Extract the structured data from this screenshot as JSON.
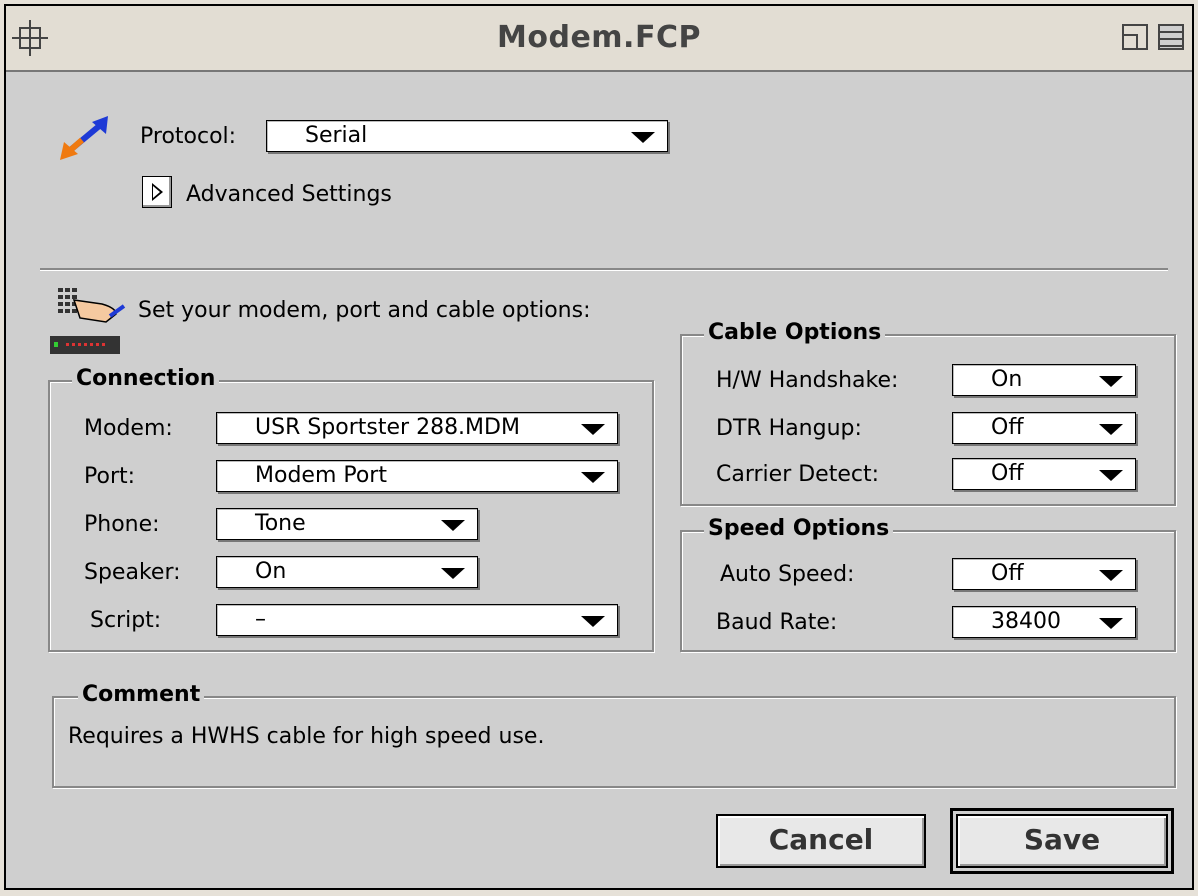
{
  "window": {
    "title": "Modem.FCP"
  },
  "protocol": {
    "label": "Protocol:",
    "value": "Serial"
  },
  "advanced": {
    "label": "Advanced Settings"
  },
  "intro": {
    "text": "Set your modem, port and cable options:"
  },
  "connection": {
    "title": "Connection",
    "modem": {
      "label": "Modem:",
      "value": "USR Sportster 288.MDM"
    },
    "port": {
      "label": "Port:",
      "value": "Modem Port"
    },
    "phone": {
      "label": "Phone:",
      "value": "Tone"
    },
    "speaker": {
      "label": "Speaker:",
      "value": "On"
    },
    "script": {
      "label": "Script:",
      "value": "–"
    }
  },
  "cable": {
    "title": "Cable Options",
    "hw_handshake": {
      "label": "H/W Handshake:",
      "value": "On"
    },
    "dtr_hangup": {
      "label": "DTR Hangup:",
      "value": "Off"
    },
    "carrier_detect": {
      "label": "Carrier Detect:",
      "value": "Off"
    }
  },
  "speed": {
    "title": "Speed Options",
    "auto_speed": {
      "label": "Auto Speed:",
      "value": "Off"
    },
    "baud_rate": {
      "label": "Baud Rate:",
      "value": "38400"
    }
  },
  "comment": {
    "title": "Comment",
    "text": "Requires a HWHS cable for high speed use."
  },
  "buttons": {
    "cancel": "Cancel",
    "save": "Save"
  },
  "icons": {
    "protocol": "double-arrow-icon",
    "modem_setup": "hand-keypad-modem-icon",
    "close": "close-box-icon",
    "zoom": "zoom-box-icon",
    "collapse": "collapse-box-icon"
  }
}
